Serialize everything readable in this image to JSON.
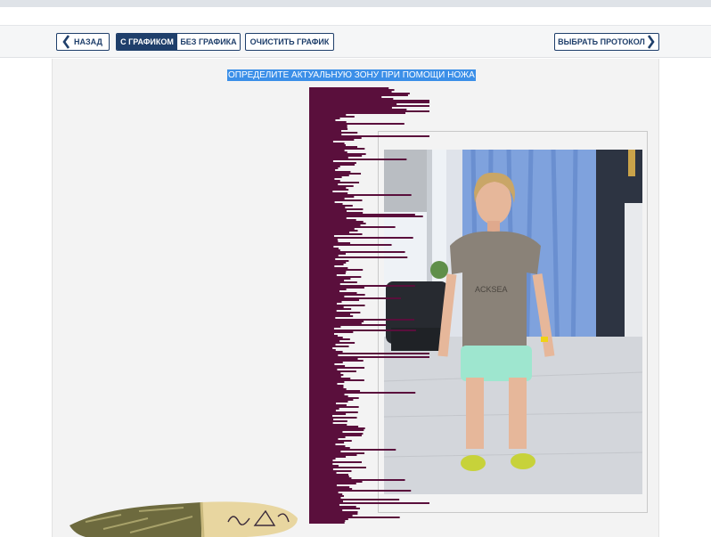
{
  "toolbar": {
    "back_label": "НАЗАД",
    "with_graph_label": "С ГРАФИКОМ",
    "without_graph_label": "БЕЗ ГРАФИКА",
    "clear_graph_label": "ОЧИСТИТЬ ГРАФИК",
    "choose_protocol_label": "ВЫБРАТЬ ПРОТОКОЛ",
    "graph_mode_selected": "С ГРАФИКОМ"
  },
  "main": {
    "instruction": "ОПРЕДЕЛИТЕ АКТУАЛЬНУЮ ЗОНУ ПРИ ПОМОЩИ НОЖА"
  },
  "photo": {
    "shirt_text": "ACKSEA",
    "lock_icon": "lock-icon"
  },
  "colors": {
    "accent": "#1f3f6b",
    "graph": "#5a0f3c",
    "highlight": "#3b8fe8"
  },
  "icons": {
    "back": "chevron-left-icon",
    "forward": "chevron-right-icon"
  }
}
